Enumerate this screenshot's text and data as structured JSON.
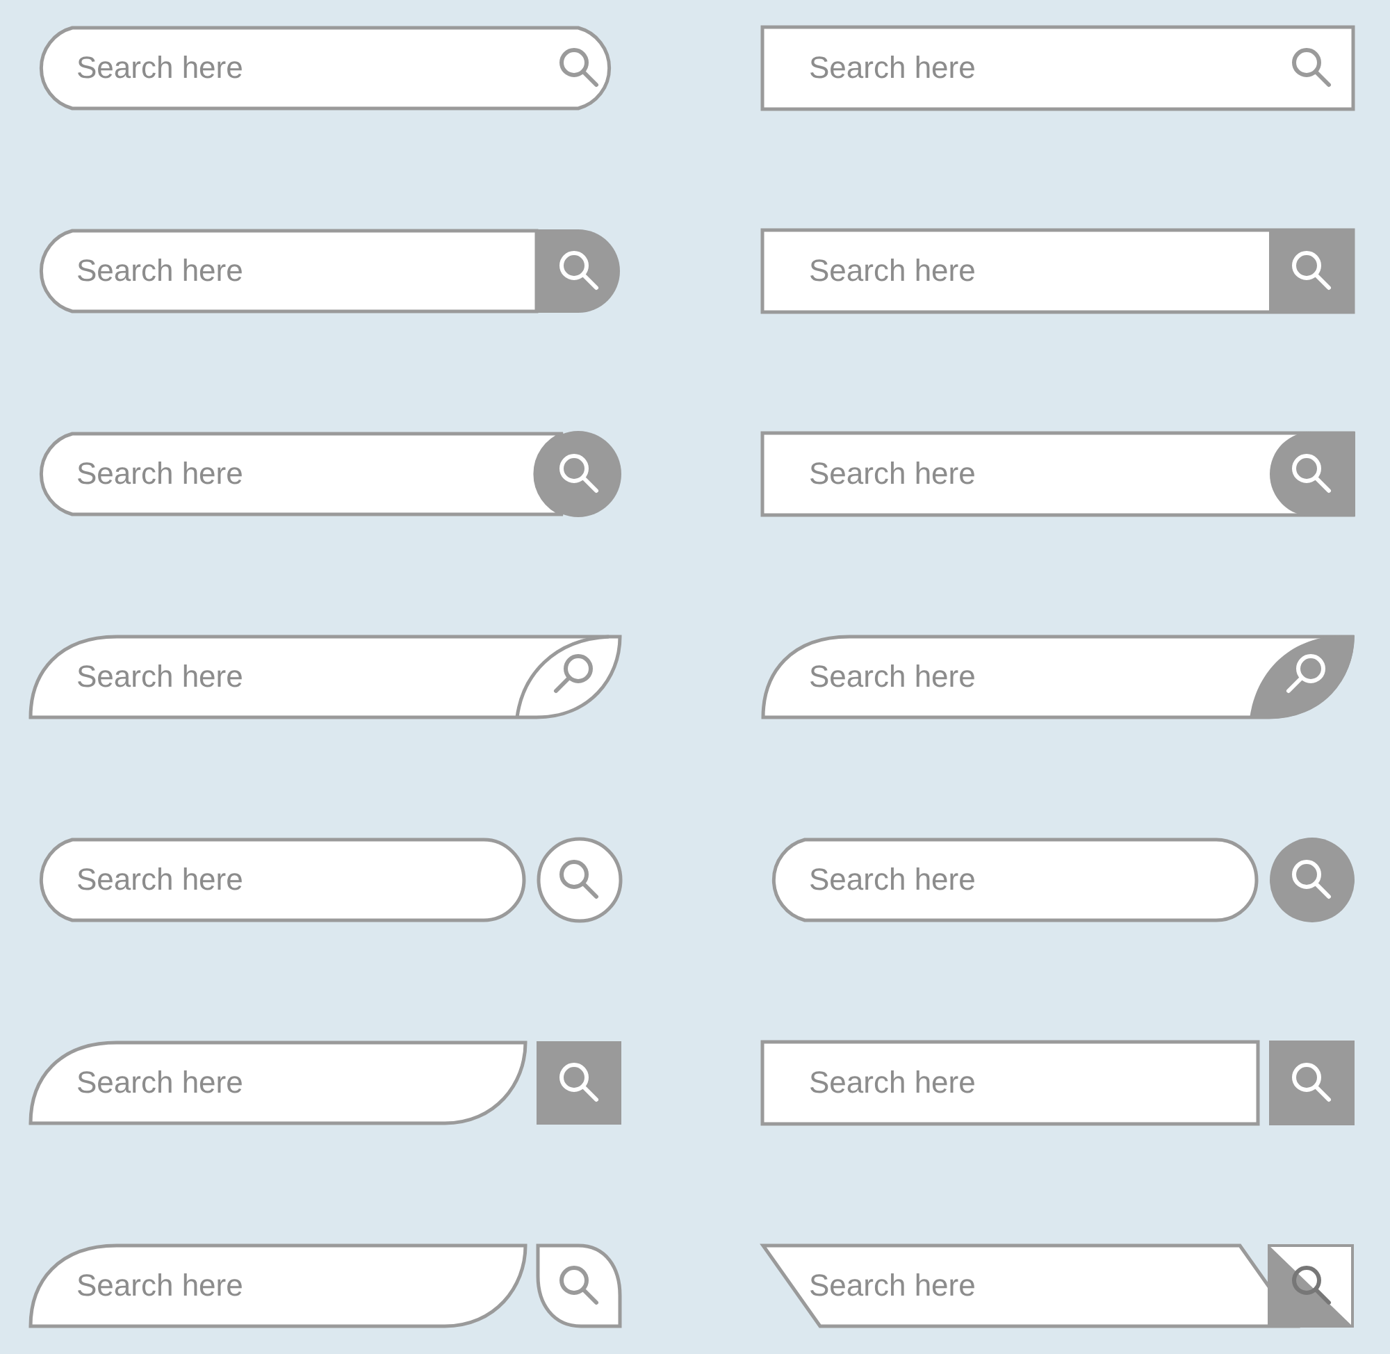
{
  "search_bars": [
    {
      "kind": "pill-icon",
      "placeholder": "Search here"
    },
    {
      "kind": "rect-icon",
      "placeholder": "Search here"
    },
    {
      "kind": "pill-square-button",
      "placeholder": "Search here"
    },
    {
      "kind": "rect-square-button",
      "placeholder": "Search here"
    },
    {
      "kind": "pill-circle-button",
      "placeholder": "Search here"
    },
    {
      "kind": "rect-circle-button",
      "placeholder": "Search here"
    },
    {
      "kind": "leaf-outline-button",
      "placeholder": "Search here"
    },
    {
      "kind": "leaf-filled-button",
      "placeholder": "Search here"
    },
    {
      "kind": "pill-separate-circle-outline",
      "placeholder": "Search here"
    },
    {
      "kind": "pill-separate-circle-filled",
      "placeholder": "Search here"
    },
    {
      "kind": "tab-separate-square",
      "placeholder": "Search here"
    },
    {
      "kind": "rect-separate-square",
      "placeholder": "Search here"
    },
    {
      "kind": "tab-separate-rounded-outline",
      "placeholder": "Search here"
    },
    {
      "kind": "slant-separate-split",
      "placeholder": "Search here"
    }
  ]
}
